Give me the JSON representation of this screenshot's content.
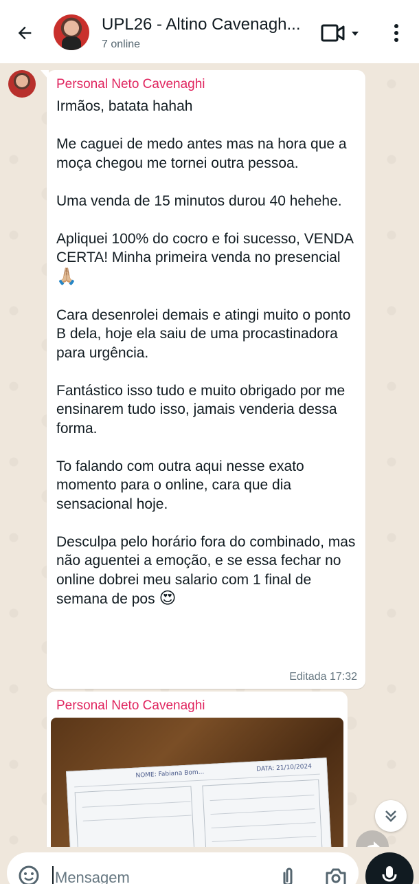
{
  "header": {
    "title": "UPL26 - Altino Cavenagh...",
    "status": "7 online"
  },
  "icons": {
    "back": "arrow-left-icon",
    "video": "video-call-icon",
    "menu": "more-vertical-icon",
    "scroll": "double-chevron-down-icon",
    "forward": "forward-icon",
    "emoji": "sticker-smiley-icon",
    "attach": "paperclip-icon",
    "camera": "camera-icon",
    "mic": "microphone-icon"
  },
  "colors": {
    "sender_name": "#e0245e",
    "chat_background": "#efe7dc",
    "bubble": "#ffffff"
  },
  "messages": [
    {
      "sender": "Personal Neto Cavenaghi",
      "paragraphs": [
        "Irmãos, batata hahah",
        "Me caguei de medo antes mas na hora que a moça chegou me tornei outra pessoa.",
        "Uma venda de 15 minutos durou 40 hehehe.",
        "Apliquei 100% do cocro e foi sucesso, VENDA CERTA! Minha primeira venda no presencial",
        "Cara desenrolei demais e atingi muito o ponto B dela, hoje ela saiu de uma procastinadora para urgência.",
        "Fantástico isso tudo e muito obrigado por me ensinarem tudo isso, jamais venderia dessa forma.",
        "To falando com outra aqui nesse exato momento para o online, cara que dia sensacional hoje.",
        "Desculpa pelo horário fora do combinado, mas não aguentei a emoção, e se essa fechar no online dobrei meu salario com 1 final de semana de pos"
      ],
      "emoji_after_p4": "🙏🏼",
      "emoji_after_p8": "😍",
      "edited_label": "Editada",
      "time": "17:32"
    },
    {
      "sender": "Personal Neto Cavenaghi",
      "photo_text": {
        "nome": "NOME: Fabiana Bom...",
        "data": "DATA: 21/10/2024"
      }
    }
  ],
  "input": {
    "placeholder": "Mensagem"
  }
}
